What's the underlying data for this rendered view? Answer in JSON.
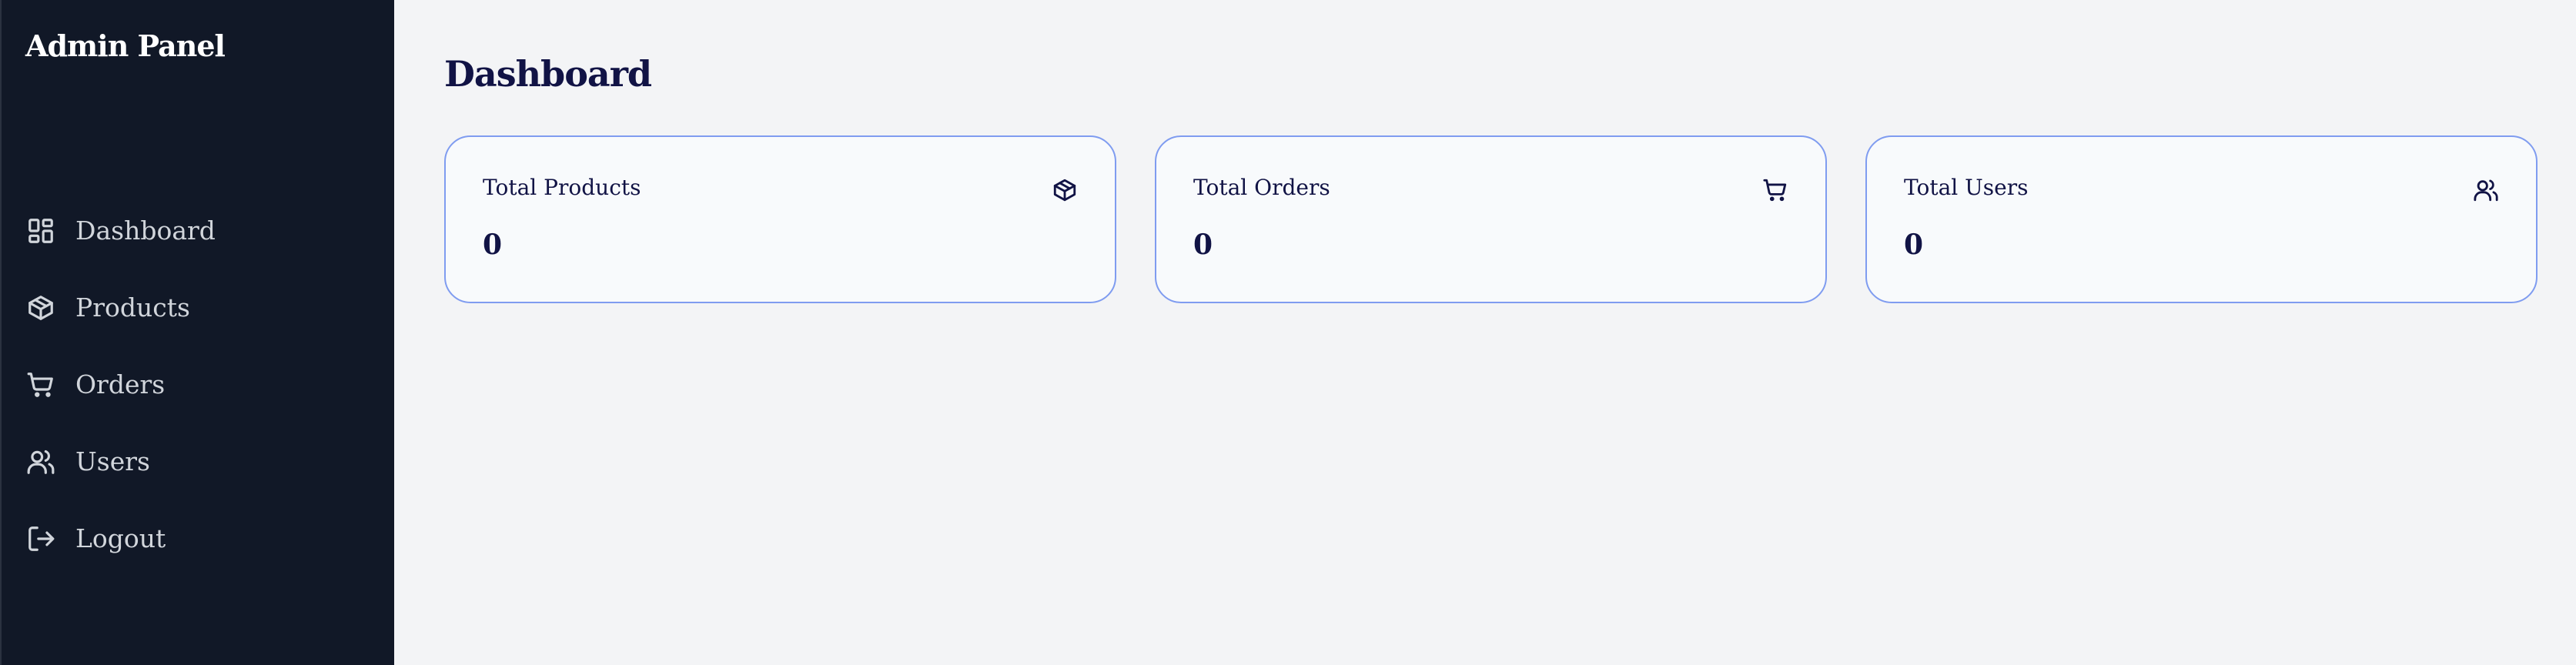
{
  "sidebar": {
    "brand": "Admin Panel",
    "items": [
      {
        "label": "Dashboard",
        "icon": "dashboard-grid-icon"
      },
      {
        "label": "Products",
        "icon": "package-icon"
      },
      {
        "label": "Orders",
        "icon": "shopping-cart-icon"
      },
      {
        "label": "Users",
        "icon": "users-icon"
      },
      {
        "label": "Logout",
        "icon": "logout-icon"
      }
    ]
  },
  "main": {
    "title": "Dashboard",
    "cards": [
      {
        "title": "Total Products",
        "value": "0",
        "icon": "package-icon"
      },
      {
        "title": "Total Orders",
        "value": "0",
        "icon": "shopping-cart-icon"
      },
      {
        "title": "Total Users",
        "value": "0",
        "icon": "users-icon"
      }
    ]
  },
  "colors": {
    "sidebar_bg": "#111827",
    "page_bg": "#f3f4f6",
    "card_border": "#7f9cf0",
    "title_text": "#111345"
  }
}
